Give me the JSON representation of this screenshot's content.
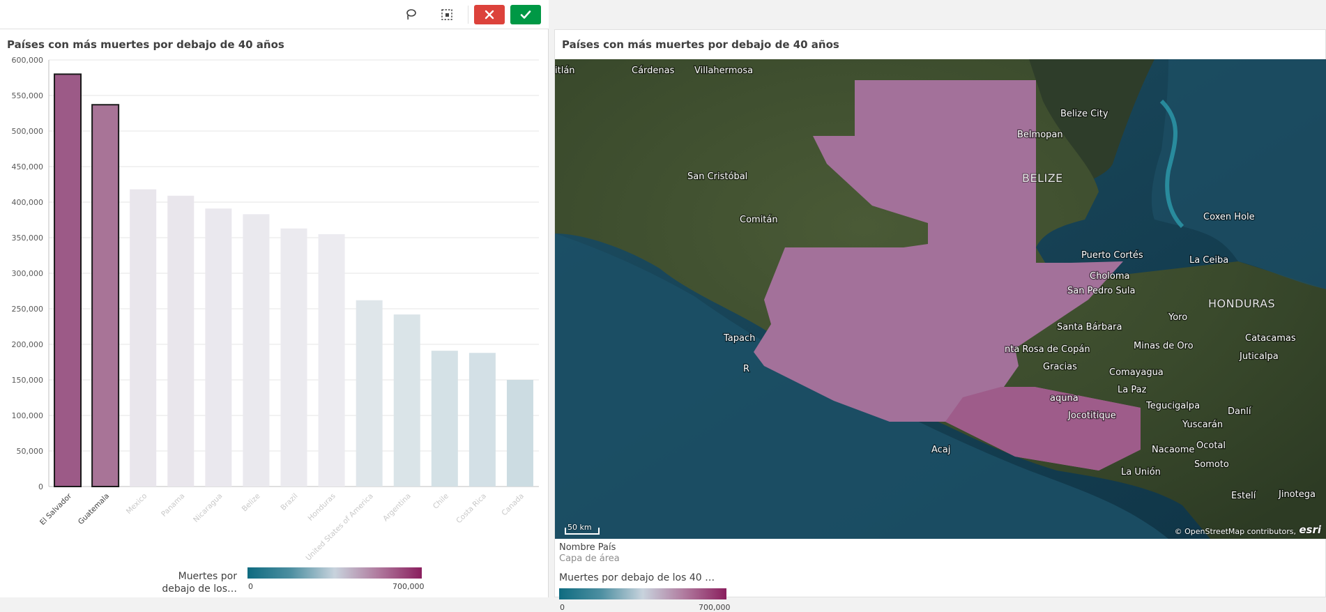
{
  "toolbar": {
    "lasso_icon": "lasso-icon",
    "select_icon": "selection-icon",
    "cancel_icon": "close-icon",
    "confirm_icon": "check-icon",
    "cancel_color": "#dc423b",
    "confirm_color": "#009845"
  },
  "left_panel": {
    "title": "Países con más muertes por debajo de 40 años",
    "legend": {
      "title_line1": "Muertes por",
      "title_line2": "debajo de los…",
      "min_label": "0",
      "max_label": "700,000"
    }
  },
  "chart_data": {
    "type": "bar",
    "title": "Países con más muertes por debajo de 40 años",
    "categories": [
      "El Salvador",
      "Guatemala",
      "Mexico",
      "Panama",
      "Nicaragua",
      "Belize",
      "Brazil",
      "Honduras",
      "United States of America",
      "Argentina",
      "Chile",
      "Costa Rica",
      "Canada"
    ],
    "values": [
      580000,
      537000,
      418000,
      409000,
      391000,
      383000,
      363000,
      355000,
      262000,
      242000,
      191000,
      188000,
      150000
    ],
    "selected": [
      true,
      true,
      false,
      false,
      false,
      false,
      false,
      false,
      false,
      false,
      false,
      false,
      false
    ],
    "colors": [
      "#9c5a87",
      "#a87497",
      "#e9e6ec",
      "#e9e6ec",
      "#eae8ee",
      "#eae9ee",
      "#ebeaef",
      "#ecebf0",
      "#dfe6ea",
      "#dae4e8",
      "#d4e1e6",
      "#d3e0e6",
      "#ccdce2"
    ],
    "label_colors": [
      "#404040",
      "#404040",
      "#c8c8c8",
      "#c8c8c8",
      "#c8c8c8",
      "#c8c8c8",
      "#c8c8c8",
      "#c8c8c8",
      "#c8c8c8",
      "#c8c8c8",
      "#c8c8c8",
      "#c8c8c8",
      "#c8c8c8"
    ],
    "ylim": [
      0,
      600000
    ],
    "yticks": [
      0,
      50000,
      100000,
      150000,
      200000,
      250000,
      300000,
      350000,
      400000,
      450000,
      500000,
      550000,
      600000
    ],
    "ytick_labels": [
      "0",
      "50,000",
      "100,000",
      "150,000",
      "200,000",
      "250,000",
      "300,000",
      "350,000",
      "400,000",
      "450,000",
      "500,000",
      "550,000",
      "600,000"
    ],
    "grid": true,
    "xlabel": "",
    "ylabel": ""
  },
  "right_panel": {
    "title": "Países con más muertes por debajo de 40 años",
    "map": {
      "cities": [
        "itlán",
        "Cárdenas",
        "Villahermosa",
        "Belize City",
        "Belmopan",
        "San Cristóbal",
        "Comitán",
        "Coxen Hole",
        "Puerto Cortés",
        "La Ceiba",
        "Choloma",
        "San Pedro Sula",
        "Santa Bárbara",
        "Yoro",
        "Tapach",
        "nta Rosa de Copán",
        "Minas de Oro",
        "Catacamas",
        "Juticalpa",
        "Gracias",
        "Comayagua",
        "La Paz",
        "aquna",
        "Tegucigalpa",
        "Danlí",
        "Jocotitique",
        "Yuscarán",
        "Acaj",
        "Nacaome",
        "Ocotal",
        "La Unión",
        "Somoto",
        "Estelí",
        "Jinotega",
        "R"
      ],
      "countries": [
        "BELIZE",
        "HONDURAS"
      ],
      "scale_label": "50 km",
      "attribution": "© OpenStreetMap contributors,",
      "logo": "esri",
      "highlight_color": "#a3719a"
    },
    "legend": {
      "layer_name": "Nombre País",
      "layer_type": "Capa de área",
      "measure_name": "Muertes por debajo de los 40 …",
      "min_label": "0",
      "max_label": "700,000"
    }
  }
}
